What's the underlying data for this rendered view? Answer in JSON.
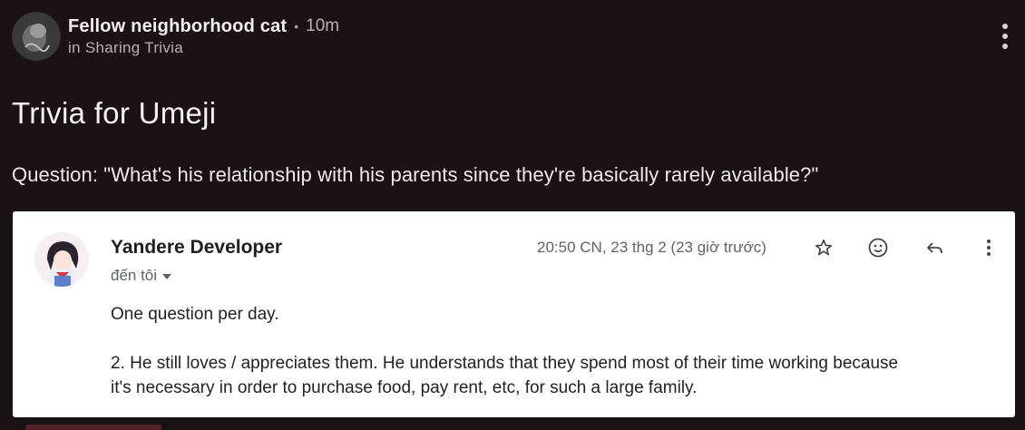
{
  "post": {
    "author": "Fellow neighborhood cat",
    "separator": "•",
    "time": "10m",
    "community": "in Sharing Trivia",
    "title": "Trivia for Umeji",
    "question": "Question: \"What's his relationship with his parents since they're basically rarely available?\"",
    "avatar_icon": "cat-avatar-icon",
    "menu_icon": "kebab-menu-icon"
  },
  "email": {
    "sender": "Yandere Developer",
    "recipient": "đến tôi",
    "date": "20:50 CN, 23 thg 2 (23 giờ trước)",
    "body_line_1": "One question per day.",
    "body_line_2": "2. He still loves / appreciates them. He understands that they spend most of their time working because",
    "body_line_3": "it's necessary in order to purchase food, pay rent, etc, for such a large family.",
    "icons": [
      "star-icon",
      "emoji-icon",
      "reply-icon",
      "more-vert-icon"
    ]
  }
}
